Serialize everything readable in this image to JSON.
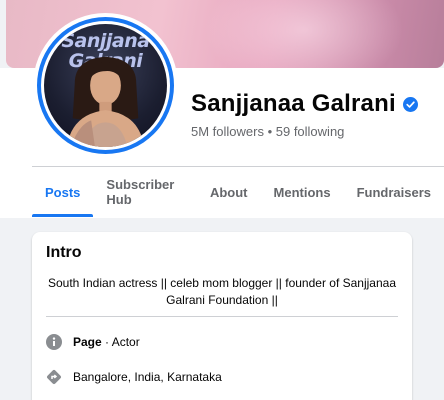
{
  "profile": {
    "name": "Sanjjanaa Galrani",
    "stats": "5M followers • 59 following",
    "avatar_text_line1": "Sanjjana",
    "avatar_text_line2": "Galrani"
  },
  "tabs": [
    {
      "label": "Posts",
      "active": true
    },
    {
      "label": "Subscriber Hub",
      "active": false
    },
    {
      "label": "About",
      "active": false
    },
    {
      "label": "Mentions",
      "active": false
    },
    {
      "label": "Fundraisers",
      "active": false
    }
  ],
  "intro": {
    "title": "Intro",
    "bio_line1": "South Indian actress || celeb mom blogger || founder of Sanjjanaa",
    "bio_line2": "Galrani Foundation ||",
    "page_label": "Page",
    "page_category": " · Actor",
    "location": "Bangalore, India, Karnataka"
  },
  "colors": {
    "accent": "#1877f2",
    "secondary_text": "#65676b",
    "background": "#f0f2f5"
  },
  "icons": {
    "verified": "verified-badge-icon",
    "info": "info-icon",
    "location": "location-pin-icon"
  }
}
